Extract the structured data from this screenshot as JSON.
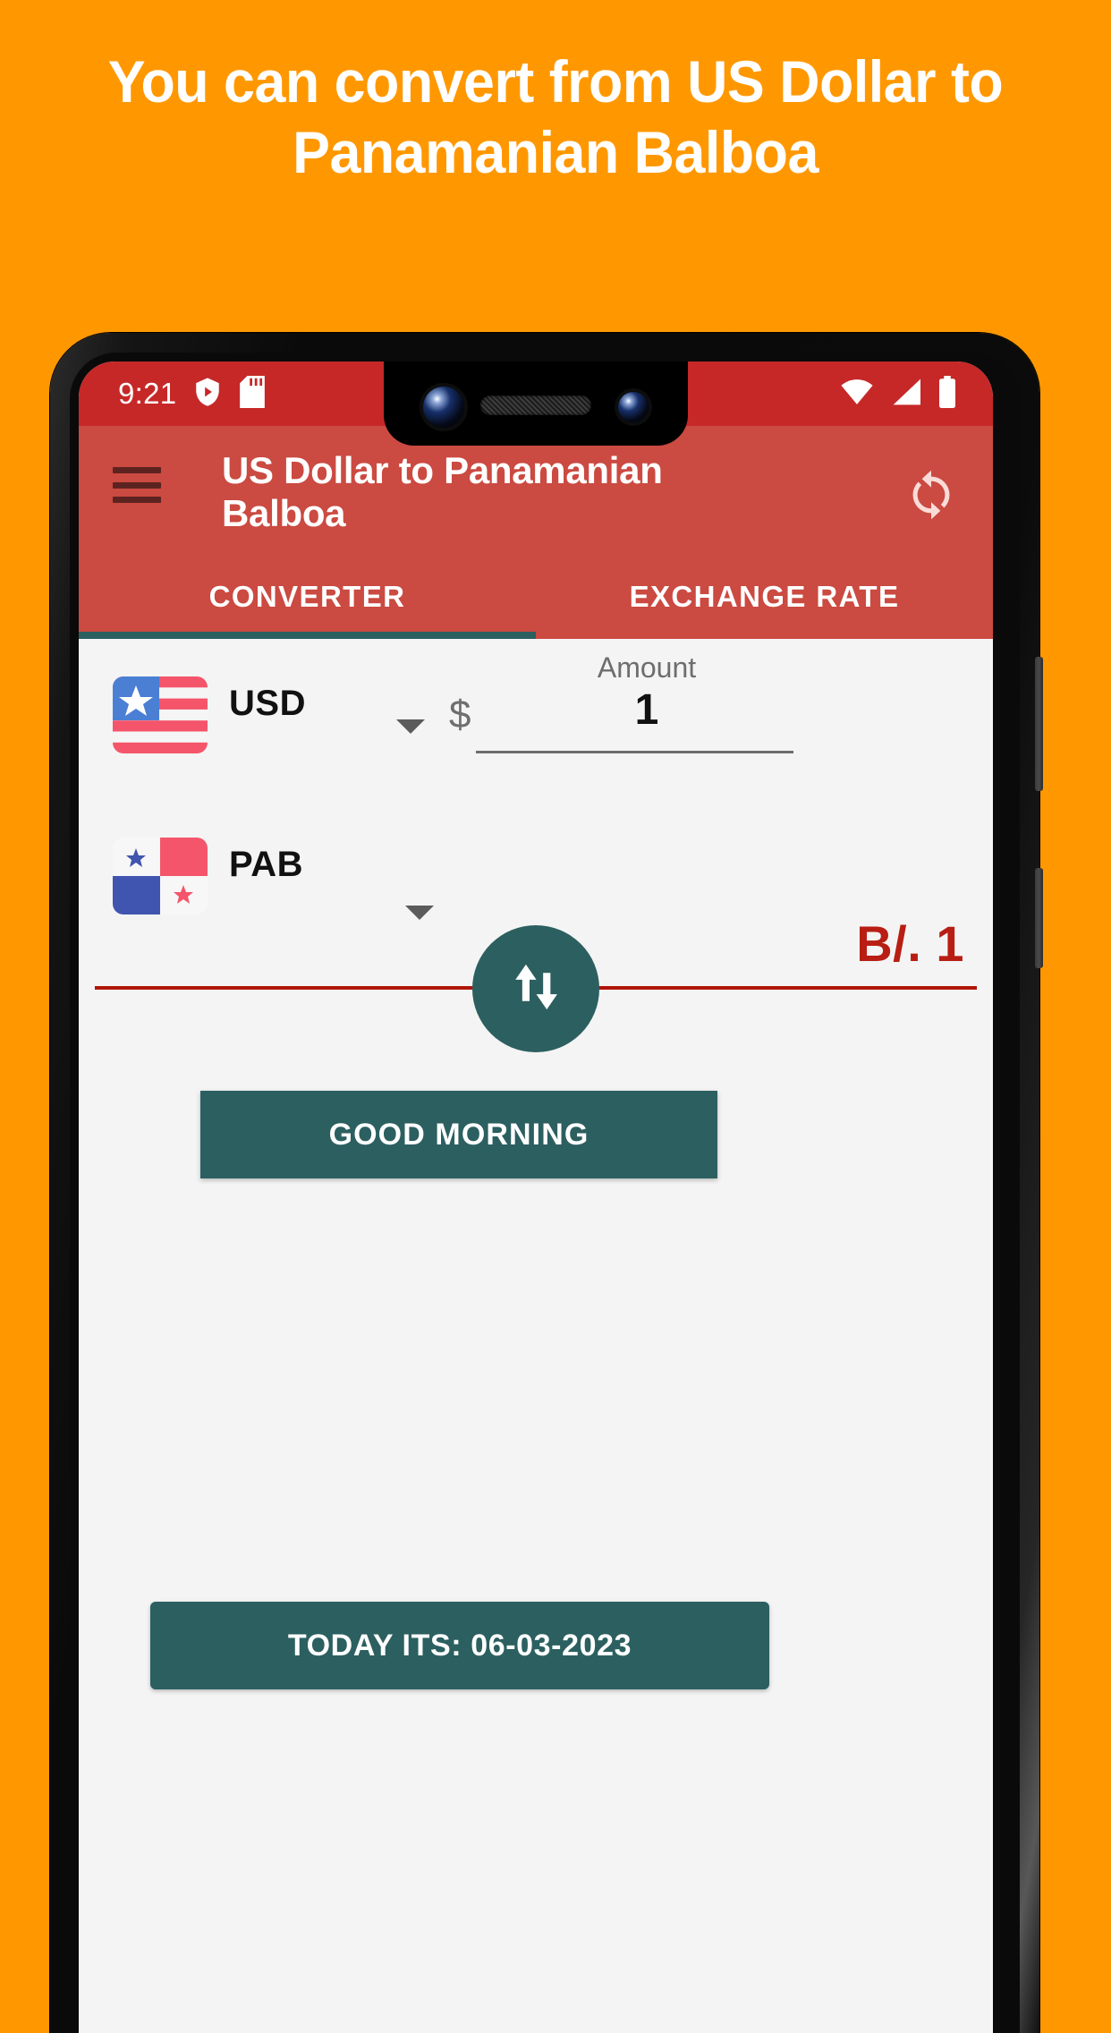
{
  "promo": {
    "headline": "You can convert from US Dollar to Panamanian Balboa",
    "background_color": "#FF9800",
    "headline_color": "#FFFFFF"
  },
  "status_bar": {
    "time": "9:21",
    "icons_left": [
      "shield-play-icon",
      "sd-card-icon"
    ],
    "icons_right": [
      "wifi-icon",
      "cellular-signal-icon",
      "battery-full-icon"
    ],
    "background_color": "#C62828"
  },
  "app_bar": {
    "menu_icon": "hamburger-menu-icon",
    "title": "US Dollar to Panamanian Balboa",
    "action_icon": "refresh-swap-icon",
    "background_color": "#CB4A41"
  },
  "tabs": {
    "items": [
      {
        "label": "CONVERTER",
        "active": true
      },
      {
        "label": "EXCHANGE RATE",
        "active": false
      }
    ],
    "indicator_color": "#2C5F60"
  },
  "converter": {
    "from": {
      "flag": "us-flag-icon",
      "code": "USD",
      "symbol": "$",
      "dropdown_icon": "chevron-down-icon"
    },
    "amount": {
      "label": "Amount",
      "value": "1"
    },
    "to": {
      "flag": "panama-flag-icon",
      "code": "PAB",
      "dropdown_icon": "chevron-down-icon"
    },
    "result": "B/. 1",
    "result_color": "#B81E13",
    "swap_icon": "swap-vertical-arrows-icon",
    "divider_color": "#B01509"
  },
  "buttons": {
    "greeting": "GOOD MORNING",
    "today": "TODAY ITS: 06-03-2023",
    "color": "#2C5F60"
  }
}
